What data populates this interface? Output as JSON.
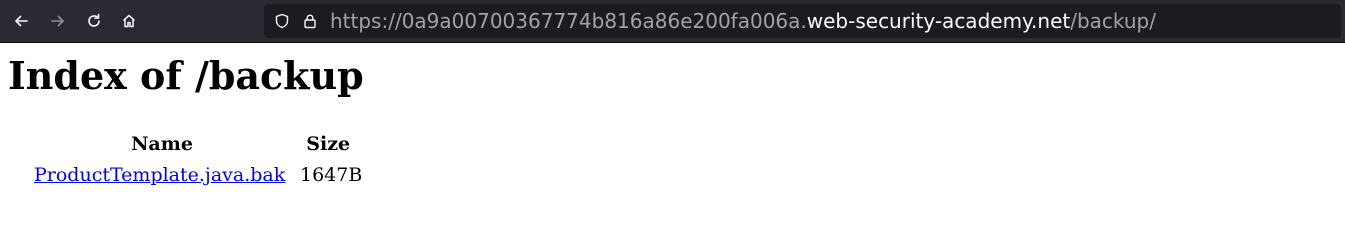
{
  "browser": {
    "nav": {
      "back": "back",
      "forward": "forward",
      "reload": "reload",
      "home": "home"
    },
    "url": {
      "prefix": "https://0a9a00700367774b816a86e200fa006a.",
      "domain": "web-security-academy.net",
      "path": "/backup/"
    },
    "colors": {
      "toolbar": "#2b2a33",
      "urlbar": "#1c1b22",
      "url_dim": "#a3a2a8",
      "url_main": "#fbfbfe"
    }
  },
  "page": {
    "title": "Index of /backup",
    "table": {
      "headers": [
        "Name",
        "Size"
      ],
      "rows": [
        {
          "name": "ProductTemplate.java.bak",
          "size": "1647B"
        }
      ]
    },
    "colors": {
      "link": "#0000ee"
    }
  }
}
